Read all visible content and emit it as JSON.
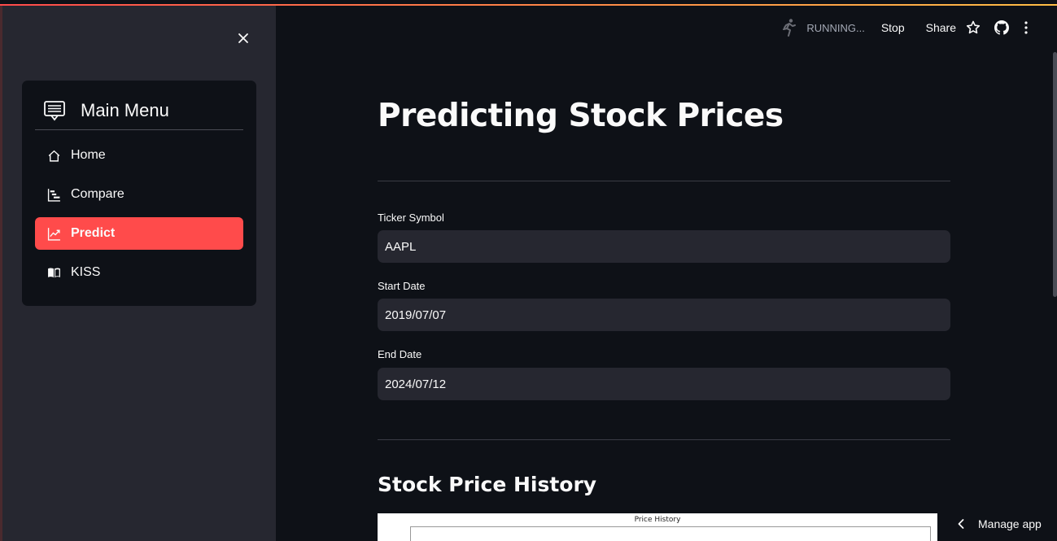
{
  "toolbar": {
    "status": "RUNNING...",
    "stop_label": "Stop",
    "share_label": "Share"
  },
  "sidebar": {
    "menu_title": "Main Menu",
    "items": [
      {
        "label": "Home",
        "icon": "house-icon",
        "active": false
      },
      {
        "label": "Compare",
        "icon": "bar-chart-steps-icon",
        "active": false
      },
      {
        "label": "Predict",
        "icon": "graph-up-icon",
        "active": true
      },
      {
        "label": "KISS",
        "icon": "book-icon",
        "active": false
      }
    ]
  },
  "main": {
    "title": "Predicting Stock Prices",
    "ticker_label": "Ticker Symbol",
    "ticker_value": "AAPL",
    "start_label": "Start Date",
    "start_value": "2019/07/07",
    "end_label": "End Date",
    "end_value": "2024/07/12",
    "section_title": "Stock Price History",
    "chart_title": "Price History"
  },
  "manage_app": "Manage app",
  "colors": {
    "accent": "#ff4b4b",
    "background": "#0e1117",
    "sidebar": "#262730"
  }
}
